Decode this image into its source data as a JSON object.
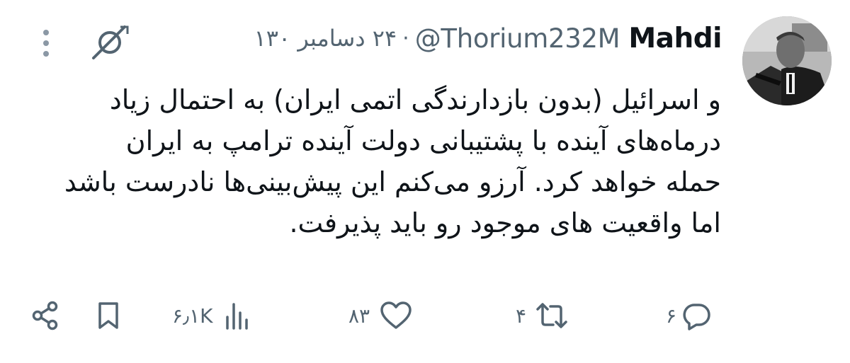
{
  "tweet": {
    "author": {
      "display_name": "Mahdi",
      "handle": "@Thorium232M"
    },
    "separator": "·",
    "date": "۲۴ دسامبر ۱۳۰",
    "text_lines": [
      "و اسرائیل (بدون بازدارندگی اتمی ایران) به احتمال زیاد",
      "درماه‌های آینده با پشتیبانی دولت آینده ترامپ به ایران",
      "حمله خواهد کرد. آرزو می‌کنم این پیش‌بینی‌ها نادرست باشد",
      "اما واقعیت های موجود رو باید پذیرفت."
    ]
  },
  "actions": {
    "reply_count": "۶",
    "retweet_count": "۴",
    "like_count": "۸۳",
    "views_count": "۶٫۱K"
  },
  "icons": {
    "avatar": "avatar",
    "grok": "grok-icon",
    "more": "more-dots-icon",
    "reply": "reply-icon",
    "retweet": "retweet-icon",
    "like": "heart-icon",
    "views": "views-bar-icon",
    "bookmark": "bookmark-icon",
    "share": "share-icon"
  },
  "colors": {
    "text": "#0f1419",
    "secondary": "#536471",
    "background": "#ffffff"
  }
}
